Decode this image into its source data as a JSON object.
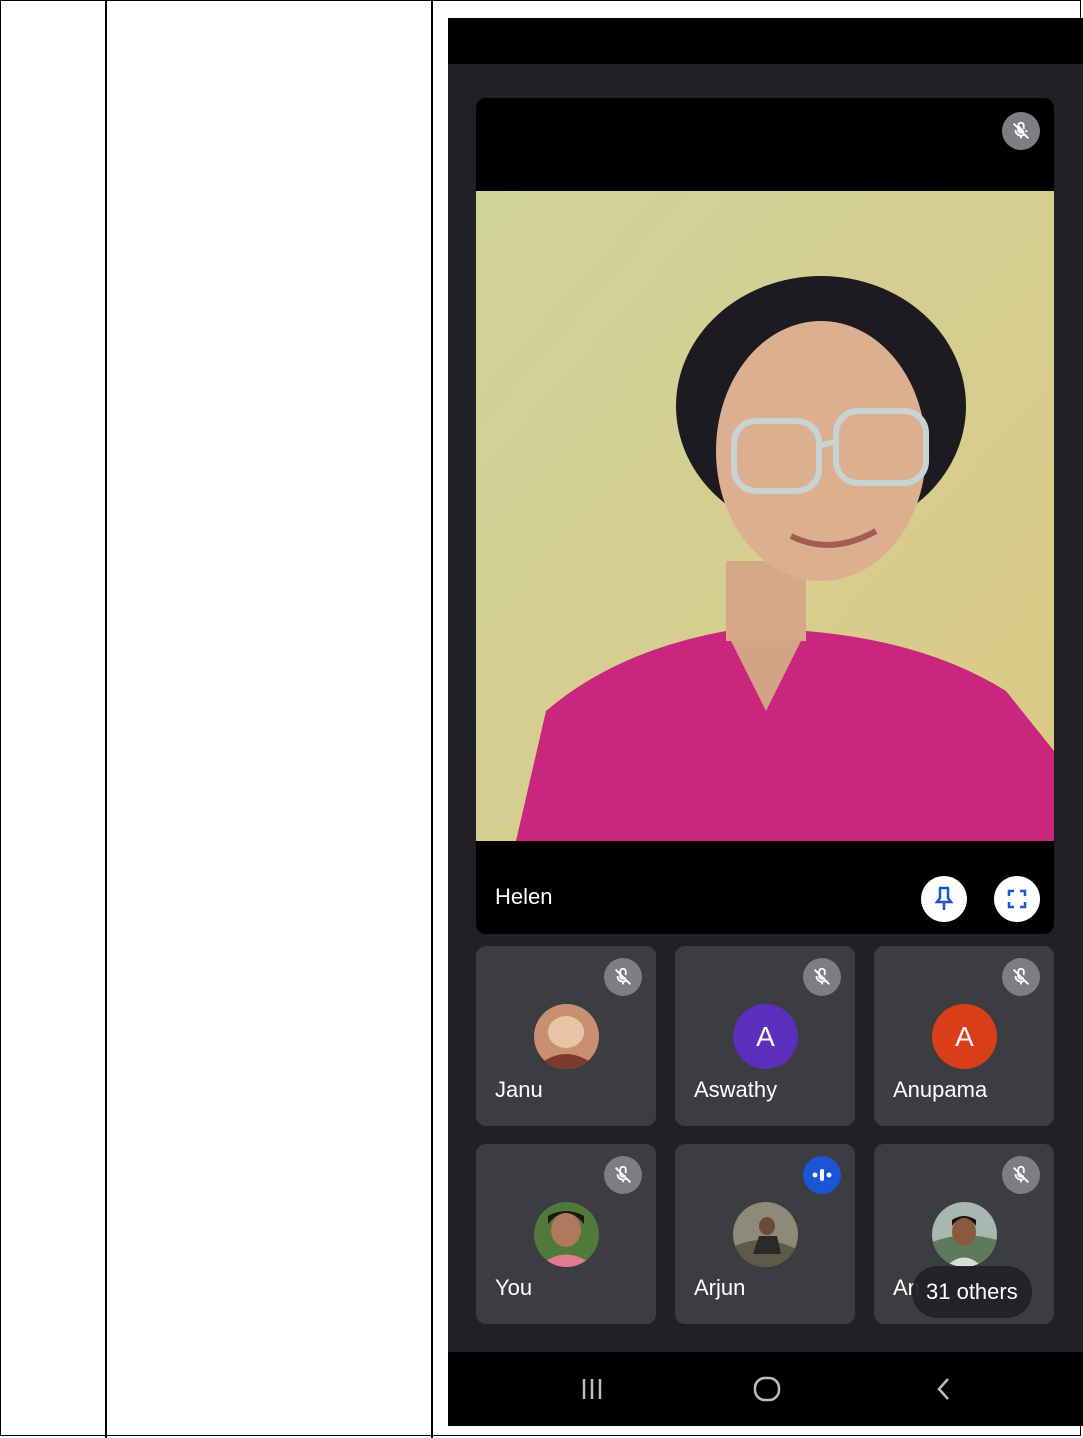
{
  "main_participant": {
    "name": "Helen"
  },
  "participants": [
    {
      "name": "Janu",
      "avatar_type": "photo",
      "status_icon": "mic-off-icon"
    },
    {
      "name": "Aswathy",
      "avatar_type": "letter",
      "initial": "A",
      "avatar_color": "#5a2fbd",
      "status_icon": "mic-off-icon"
    },
    {
      "name": "Anupama",
      "avatar_type": "letter",
      "initial": "A",
      "avatar_color": "#d93d19",
      "status_icon": "mic-off-icon"
    },
    {
      "name": "You",
      "avatar_type": "photo",
      "status_icon": "mic-off-icon"
    },
    {
      "name": "Arjun",
      "avatar_type": "photo",
      "status_icon": "speaking-icon"
    },
    {
      "name": "An",
      "avatar_type": "photo",
      "status_icon": "mic-off-icon"
    }
  ],
  "others_count_label": "31 others",
  "colors": {
    "background": "#202124",
    "tile": "#3c3d40",
    "speaking_indicator": "#1a55d6",
    "pin_icon": "#1a55d6"
  },
  "nav_icons": [
    "recent-apps-icon",
    "home-icon",
    "back-icon"
  ]
}
